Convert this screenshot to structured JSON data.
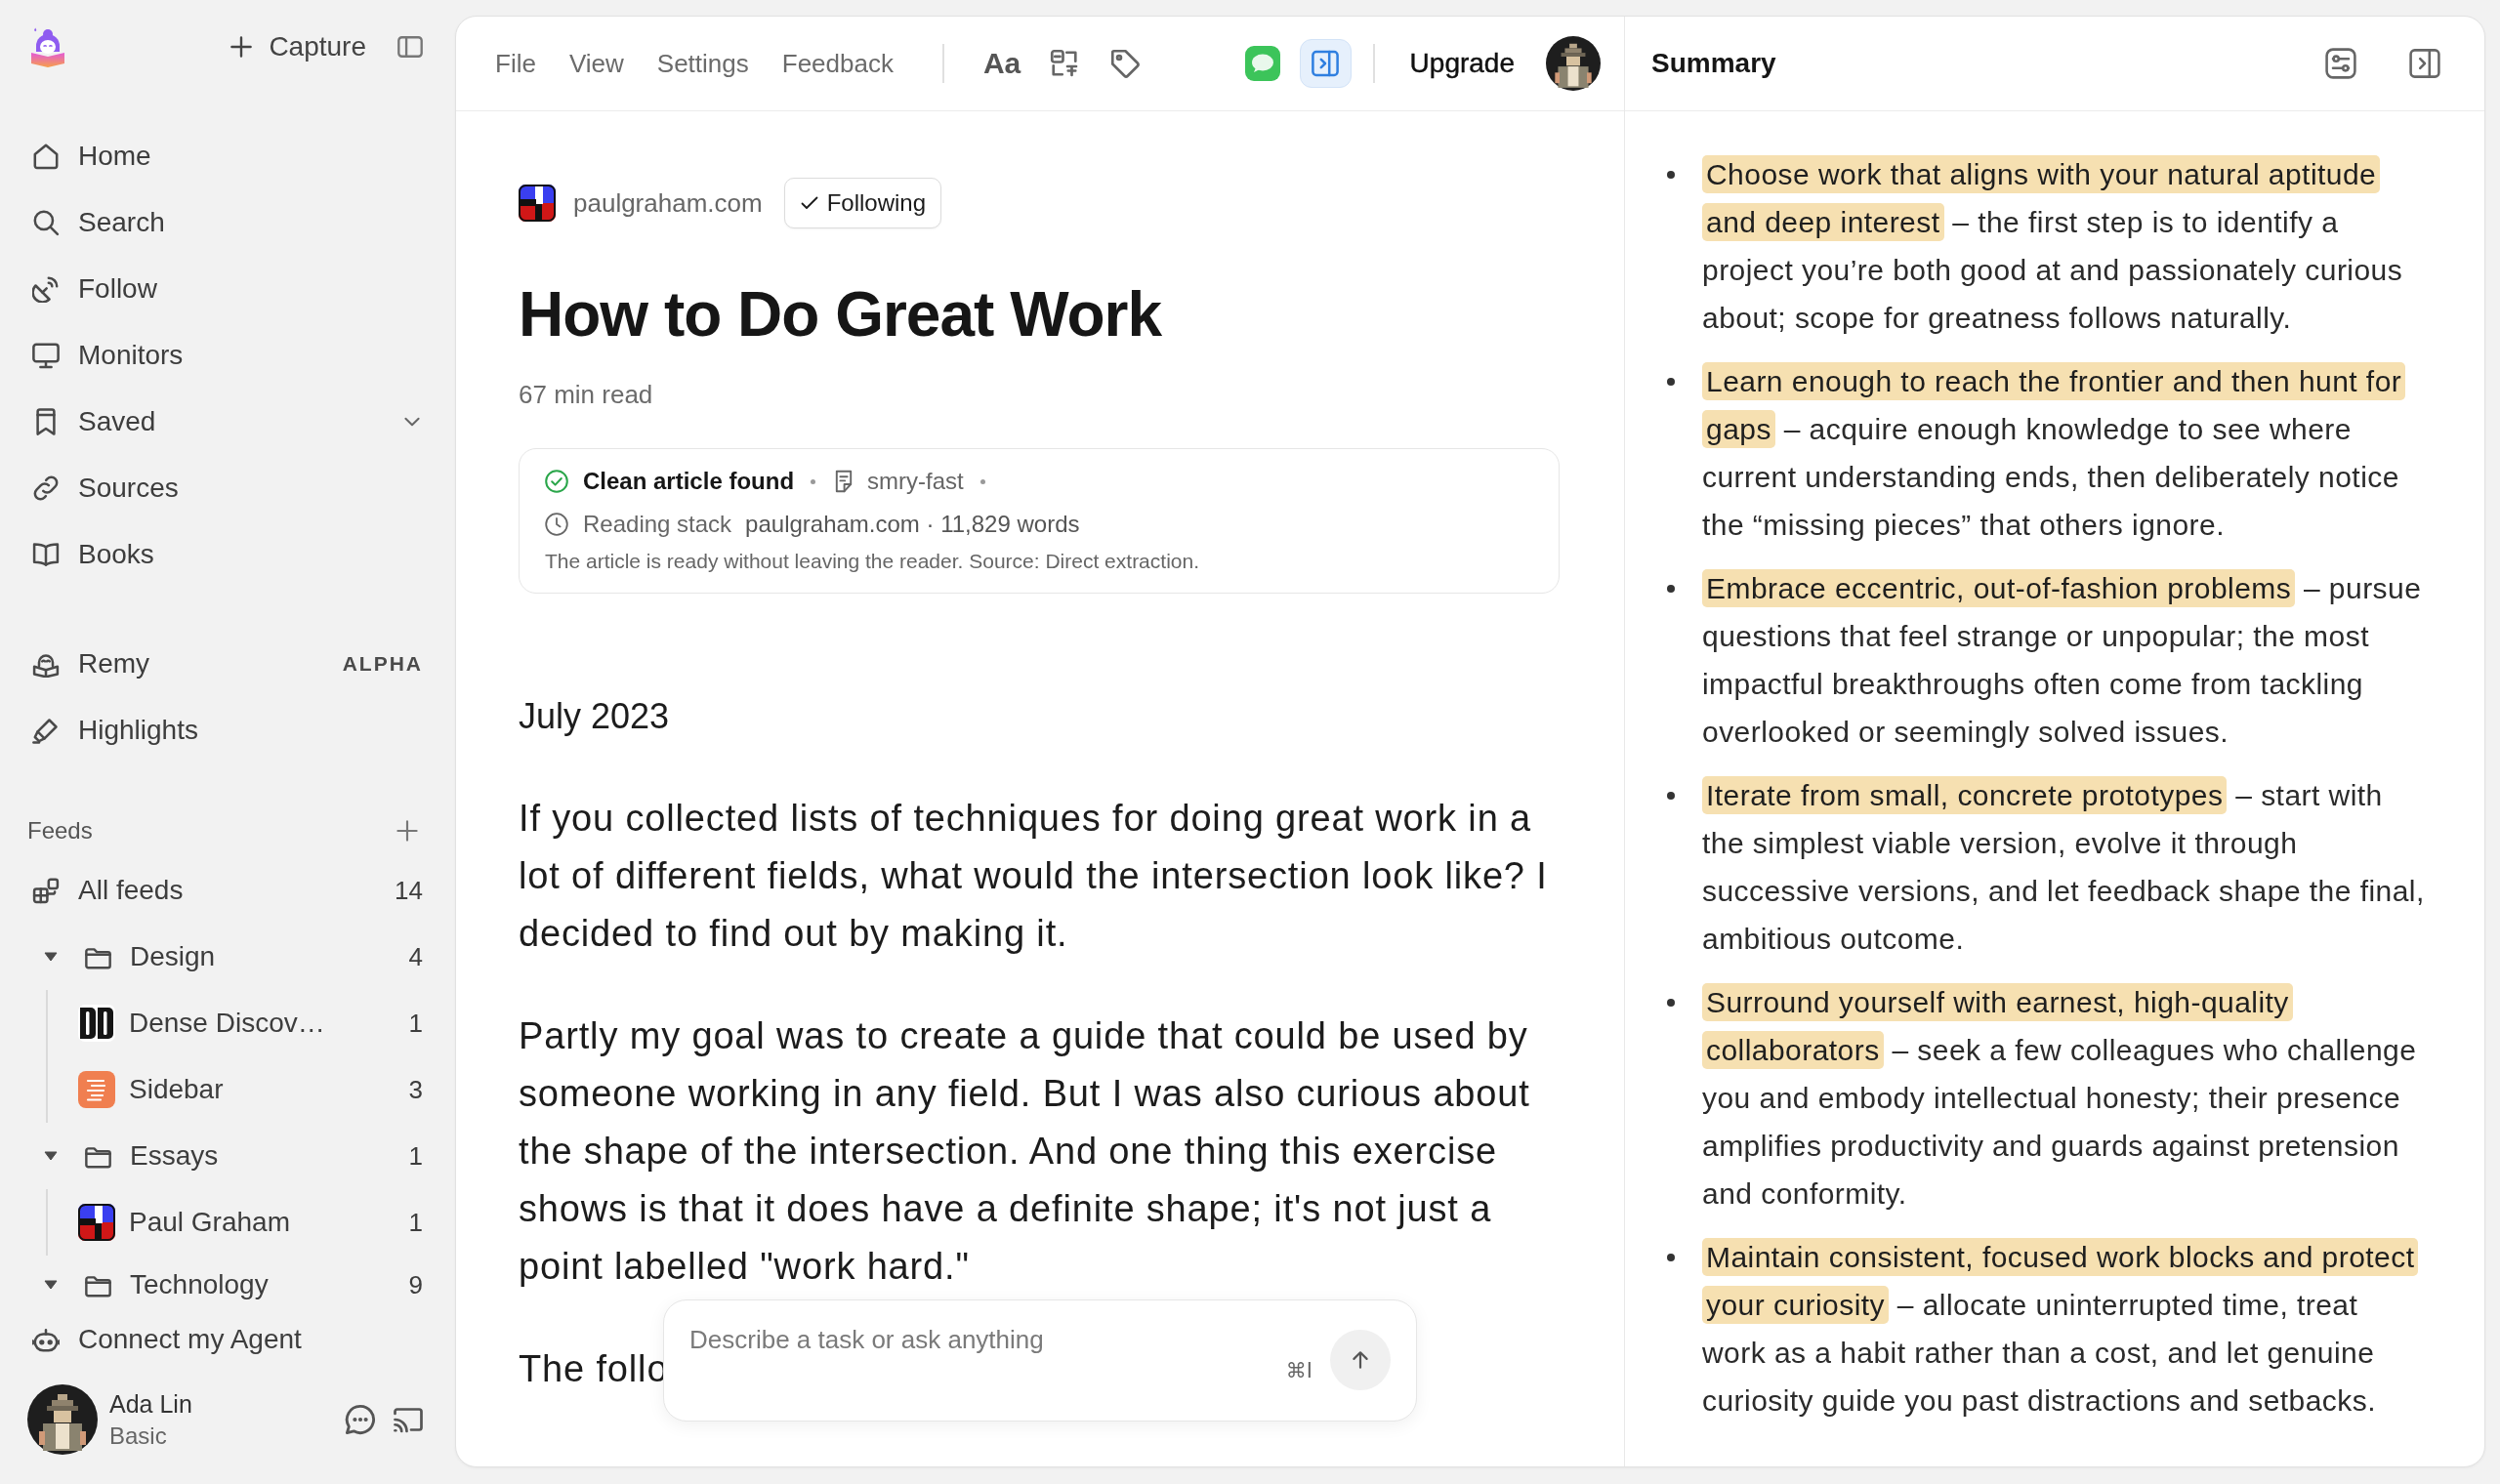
{
  "sidebar": {
    "capture_button": "Capture",
    "nav": [
      {
        "label": "Home",
        "kind": "link"
      },
      {
        "label": "Search",
        "kind": "link"
      },
      {
        "label": "Follow",
        "kind": "link"
      },
      {
        "label": "Monitors",
        "kind": "link"
      },
      {
        "label": "Saved",
        "kind": "group"
      },
      {
        "label": "Sources",
        "kind": "link"
      },
      {
        "label": "Books",
        "kind": "link"
      }
    ],
    "tools": [
      {
        "label": "Remy",
        "badge": "ALPHA"
      },
      {
        "label": "Highlights"
      }
    ],
    "feeds": {
      "title": "Feeds",
      "items": [
        {
          "label": "All feeds",
          "count": "14",
          "kind": "all"
        },
        {
          "label": "Design",
          "count": "4",
          "kind": "folder",
          "expanded": true,
          "children": [
            {
              "label": "Dense Discov…",
              "count": "1"
            },
            {
              "label": "Sidebar",
              "count": "3"
            }
          ]
        },
        {
          "label": "Essays",
          "count": "1",
          "kind": "folder",
          "expanded": true,
          "children": [
            {
              "label": "Paul Graham",
              "count": "1"
            }
          ]
        },
        {
          "label": "Technology",
          "count": "9",
          "kind": "folder",
          "expanded": true
        }
      ]
    },
    "agent_link": "Connect my Agent",
    "user": {
      "name": "Ada Lin",
      "plan": "Basic"
    }
  },
  "toolbar": {
    "menu": [
      "File",
      "View",
      "Settings",
      "Feedback"
    ],
    "text_style": "Aa",
    "summary_toggle": {
      "on": true
    },
    "upgrade": "Upgrade"
  },
  "article": {
    "source": "paulgraham.com",
    "follow": {
      "label": "Following",
      "following": true
    },
    "title": "How to Do Great Work",
    "read_time": "67 min read",
    "status": {
      "title": "Clean article found",
      "extractor": "smry-fast",
      "label": "Reading stack",
      "detail": "paulgraham.com · 11,829 words",
      "note": "The article is ready without leaving the reader. Source: Direct extraction."
    },
    "date": "July 2023",
    "paragraphs": [
      "If you collected lists of techniques for doing great work in a lot of different fields, what would the intersection look like? I decided to find out by making it.",
      "Partly my goal was to create a guide that could be used by someone working in any field. But I was also curious about the shape of the intersection. And one thing this exercise shows is that it does have a definite shape; it's not just a point labelled \"work hard.\"",
      "The follo"
    ]
  },
  "composer": {
    "placeholder": "Describe a task or ask anything",
    "shortcut": "⌘I"
  },
  "summary": {
    "title": "Summary",
    "points": [
      {
        "highlight": "Choose work that aligns with your natural aptitude and deep interest",
        "text": "– the first step is to identify a project you’re both good at and passionately curious about; scope for greatness follows naturally."
      },
      {
        "highlight": "Learn enough to reach the frontier and then hunt for gaps",
        "text": "– acquire enough knowledge to see where current understanding ends, then deliberately notice the “missing pieces” that others ignore."
      },
      {
        "highlight": "Embrace eccentric, out-of-fashion problems",
        "text": "– pursue questions that feel strange or unpopular; the most impactful breakthroughs often come from tackling overlooked or seemingly solved issues."
      },
      {
        "highlight": "Iterate from small, concrete prototypes",
        "text": "– start with the simplest viable version, evolve it through successive versions, and let feedback shape the final, ambitious outcome."
      },
      {
        "highlight": "Surround yourself with earnest, high-quality collaborators",
        "text": "– seek a few colleagues who challenge you and embody intellectual honesty; their presence amplifies productivity and guards against pretension and conformity."
      },
      {
        "highlight": "Maintain consistent, focused work blocks and protect your curiosity",
        "text": "– allocate uninterrupted time, treat work as a habit rather than a cost, and let genuine curiosity guide you past distractions and setbacks."
      }
    ]
  }
}
